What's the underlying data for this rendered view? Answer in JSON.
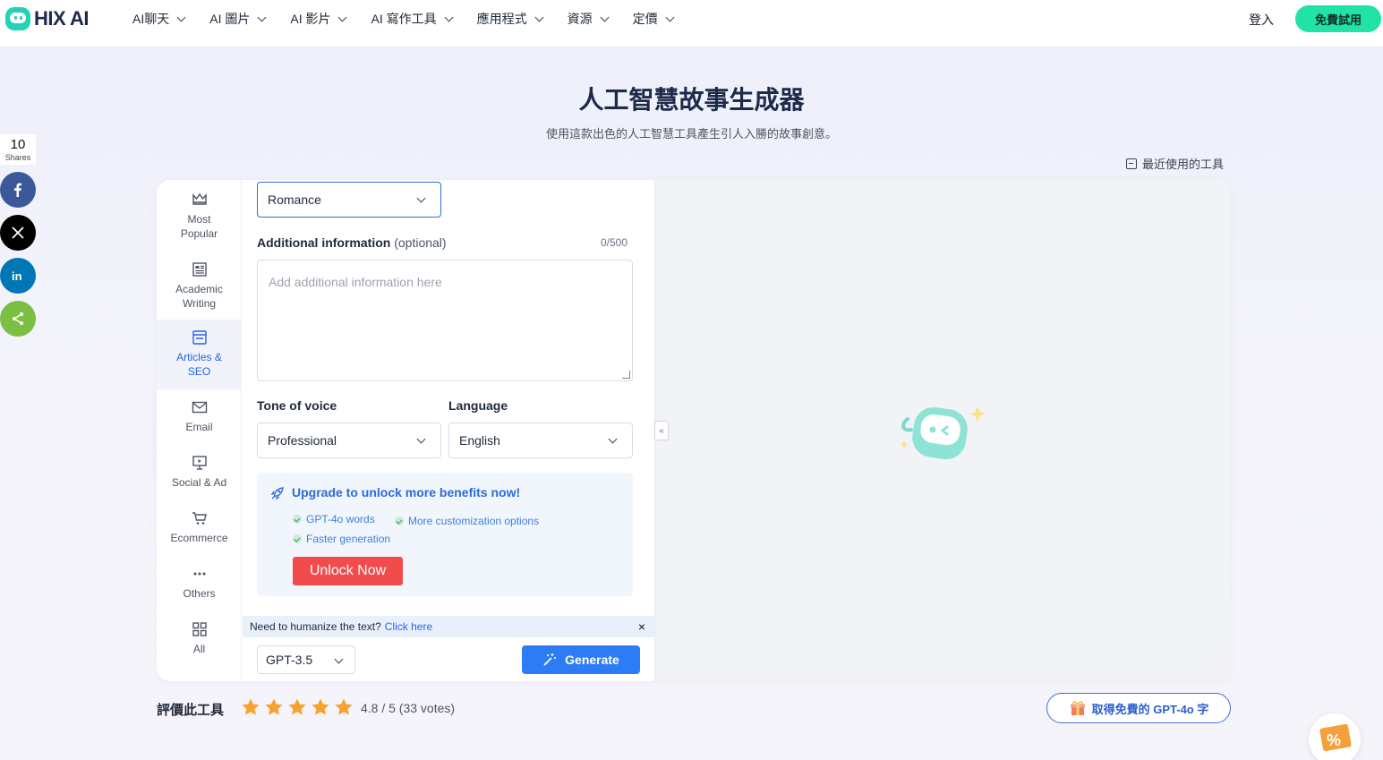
{
  "brand": {
    "name": "HIX AI",
    "accent": "#21e3a6"
  },
  "nav": {
    "items": [
      "AI聊天",
      "AI 圖片",
      "AI 影片",
      "AI 寫作工具",
      "應用程式",
      "資源",
      "定價"
    ],
    "login": "登入",
    "cta": "免費試用"
  },
  "page": {
    "title": "人工智慧故事生成器",
    "subtitle": "使用這款出色的人工智慧工具產生引人入勝的故事創意。",
    "recent_tools": "最近使用的工具"
  },
  "share": {
    "count": "10",
    "label": "Shares",
    "buttons": [
      {
        "icon": "facebook-icon",
        "color": "#3b5998"
      },
      {
        "icon": "x-icon",
        "color": "#000000"
      },
      {
        "icon": "linkedin-icon",
        "color": "#0077b5"
      },
      {
        "icon": "share-icon",
        "color": "#7bc043"
      }
    ]
  },
  "categories": [
    {
      "label1": "Most",
      "label2": "Popular",
      "icon": "crown-icon",
      "active": false
    },
    {
      "label1": "Academic",
      "label2": "Writing",
      "icon": "document-icon",
      "active": false
    },
    {
      "label1": "Articles &",
      "label2": "SEO",
      "icon": "browser-icon",
      "active": true
    },
    {
      "label1": "Email",
      "label2": "",
      "icon": "mail-icon",
      "active": false
    },
    {
      "label1": "Social & Ad",
      "label2": "",
      "icon": "monitor-icon",
      "active": false
    },
    {
      "label1": "Ecommerce",
      "label2": "",
      "icon": "cart-icon",
      "active": false
    },
    {
      "label1": "Others",
      "label2": "",
      "icon": "more-icon",
      "active": false
    },
    {
      "label1": "All",
      "label2": "",
      "icon": "grid-icon",
      "active": false
    }
  ],
  "form": {
    "genre_value": "Romance",
    "additional_label": "Additional information",
    "additional_optional": "(optional)",
    "additional_counter": "0/500",
    "additional_placeholder": "Add additional information here",
    "tone_label": "Tone of voice",
    "tone_value": "Professional",
    "language_label": "Language",
    "language_value": "English"
  },
  "upgrade": {
    "title": "Upgrade to unlock more benefits now!",
    "benefits": [
      "GPT-4o words",
      "More customization options",
      "Faster generation"
    ],
    "button": "Unlock Now"
  },
  "humanize": {
    "text": "Need to humanize the text?",
    "link": "Click here",
    "close": "×"
  },
  "footer_bar": {
    "model": "GPT-3.5",
    "generate": "Generate"
  },
  "rating": {
    "label": "評價此工具",
    "stars": 5,
    "score_text": "4.8 / 5 (33 votes)",
    "star_color": "#f7a22d"
  },
  "gift": {
    "label": "取得免費的 GPT-4o 字"
  },
  "collapse_glyph": "«"
}
